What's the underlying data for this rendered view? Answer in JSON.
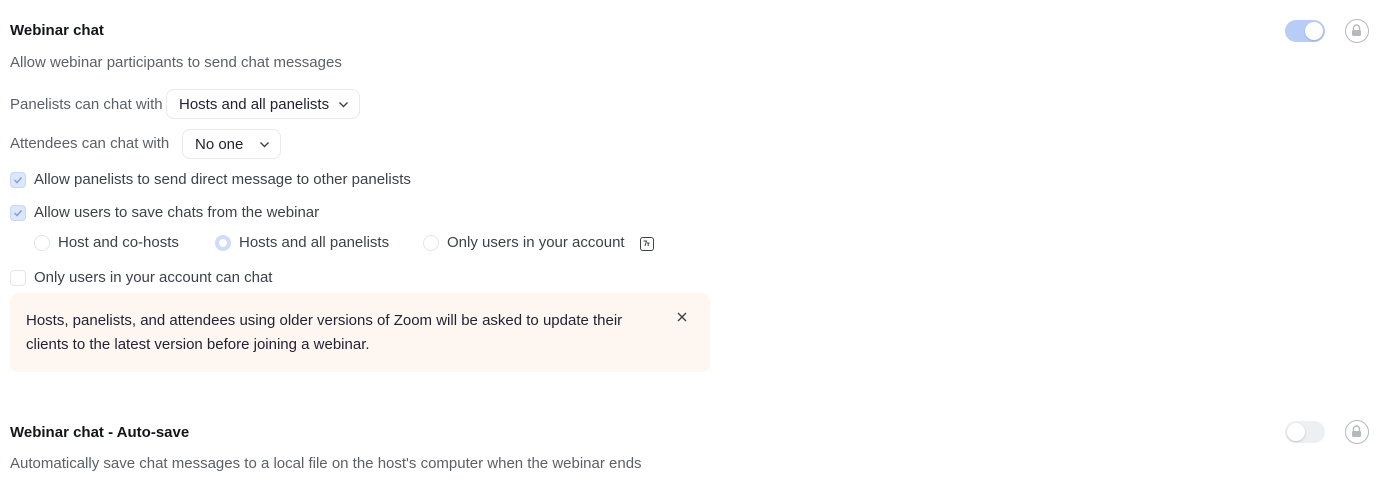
{
  "webinar_chat": {
    "title": "Webinar chat",
    "description": "Allow webinar participants to send chat messages",
    "enabled": true,
    "panelists_label": "Panelists can chat with",
    "panelists_value": "Hosts and all panelists",
    "attendees_label": "Attendees can chat with",
    "attendees_value": "No one",
    "allow_dm_label": "Allow panelists to send direct message to other panelists",
    "allow_dm_checked": true,
    "allow_save_label": "Allow users to save chats from the webinar",
    "allow_save_checked": true,
    "save_options": [
      {
        "label": "Host and co-hosts",
        "selected": false
      },
      {
        "label": "Hosts and all panelists",
        "selected": true
      },
      {
        "label": "Only users in your account",
        "selected": false
      }
    ],
    "only_account_label": "Only users in your account can chat",
    "only_account_checked": false,
    "notice_text": "Hosts, panelists, and attendees using older versions of Zoom will be asked to update their clients to the latest version before joining a webinar."
  },
  "auto_save": {
    "title": "Webinar chat - Auto-save",
    "description": "Automatically save chat messages to a local file on the host's computer when the webinar ends",
    "enabled": false
  },
  "icons": {
    "lock": "lock-icon",
    "chevron": "chevron-down-icon",
    "check": "checkmark-icon",
    "close": "close-icon",
    "badge": "version-badge-icon"
  },
  "colors": {
    "toggle_on": "#b7cdf8",
    "toggle_off": "#eeeff2",
    "notice_bg": "#fdf6f1",
    "check_fill": "#dde7fc"
  }
}
